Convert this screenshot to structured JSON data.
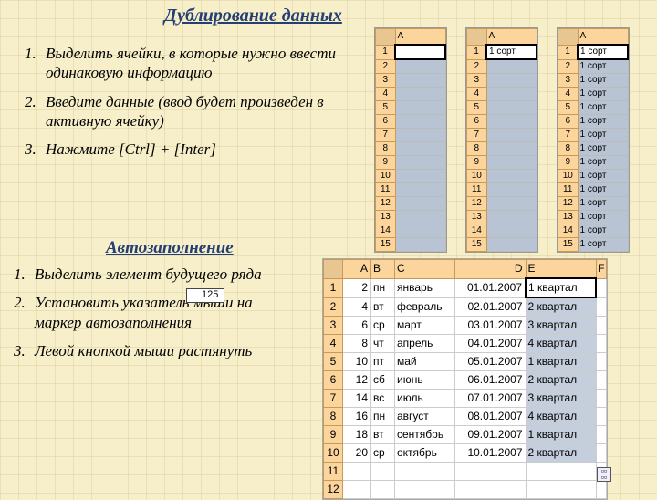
{
  "title": "Дублирование данных",
  "subtitle": "Автозаполнение",
  "steps1": [
    "Выделить ячейки, в которые нужно ввести одинаковую информацию",
    "Введите данные (ввод будет произведен в активную ячейку)",
    "Нажмите [Ctrl] + [Inter]"
  ],
  "steps2": [
    "Выделить элемент будущего ряда",
    "Установить указатель мыши на маркер автозаполнения",
    "Левой кнопкой мыши растянуть"
  ],
  "mini": {
    "colhdr": "A",
    "rows": [
      1,
      2,
      3,
      4,
      5,
      6,
      7,
      8,
      9,
      10,
      11,
      12,
      13,
      14,
      15
    ],
    "value2": "1 сорт",
    "value3": "1 сорт"
  },
  "big": {
    "cols": [
      "A",
      "B",
      "C",
      "D",
      "E"
    ],
    "rows": [
      {
        "n": 1,
        "a": 2,
        "b": "пн",
        "c": "январь",
        "d": "01.01.2007",
        "e": "1 квартал"
      },
      {
        "n": 2,
        "a": 4,
        "b": "вт",
        "c": "февраль",
        "d": "02.01.2007",
        "e": "2 квартал"
      },
      {
        "n": 3,
        "a": 6,
        "b": "ср",
        "c": "март",
        "d": "03.01.2007",
        "e": "3 квартал"
      },
      {
        "n": 4,
        "a": 8,
        "b": "чт",
        "c": "апрель",
        "d": "04.01.2007",
        "e": "4 квартал"
      },
      {
        "n": 5,
        "a": 10,
        "b": "пт",
        "c": "май",
        "d": "05.01.2007",
        "e": "1 квартал"
      },
      {
        "n": 6,
        "a": 12,
        "b": "сб",
        "c": "июнь",
        "d": "06.01.2007",
        "e": "2 квартал"
      },
      {
        "n": 7,
        "a": 14,
        "b": "вс",
        "c": "июль",
        "d": "07.01.2007",
        "e": "3 квартал"
      },
      {
        "n": 8,
        "a": 16,
        "b": "пн",
        "c": "август",
        "d": "08.01.2007",
        "e": "4 квартал"
      },
      {
        "n": 9,
        "a": 18,
        "b": "вт",
        "c": "сентябрь",
        "d": "09.01.2007",
        "e": "1 квартал"
      },
      {
        "n": 10,
        "a": 20,
        "b": "ср",
        "c": "октябрь",
        "d": "10.01.2007",
        "e": "2 квартал"
      }
    ],
    "tail": [
      11,
      12
    ]
  },
  "tooltip": "125",
  "colF": "F"
}
